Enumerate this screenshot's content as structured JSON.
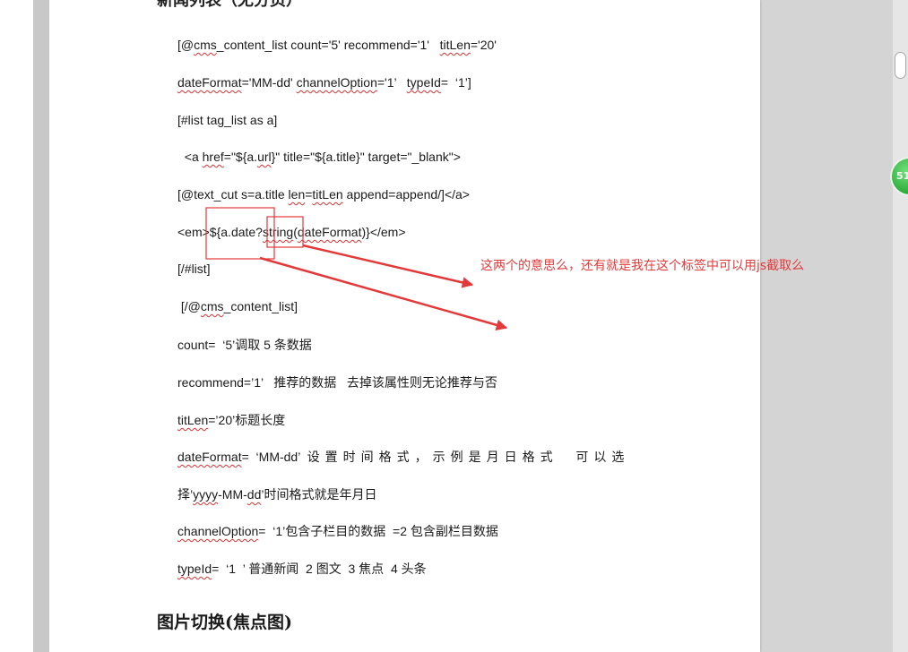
{
  "document": {
    "top_heading": "新闻列表（无分页）",
    "lines": {
      "l1_a": "[@",
      "l1_cms": "cms",
      "l1_b": "_content_list count='5' recommend='1'   ",
      "l1_titLen": "titLen",
      "l1_c": "='20'",
      "l2_dateFormat": "dateFormat",
      "l2_a": "='MM-dd' ",
      "l2_channelOption": "channelOption",
      "l2_b": "='1’   ",
      "l2_typeId": "typeId",
      "l2_c": "=  ‘1’]",
      "l3": "[#list tag_list as a]",
      "l4_a": "  <a ",
      "l4_href": "href",
      "l4_b": "=\"${a.",
      "l4_url": "url",
      "l4_c": "}\" title=\"${a.title}\" target=\"_blank\">",
      "l5_a": "[@text_cut s=a.title ",
      "l5_len": "len",
      "l5_b": "=",
      "l5_titLen": "titLen",
      "l5_c": " append=append/]</a>",
      "l6_a": "<em>${a.date?",
      "l6_string": "string",
      "l6_b": "(",
      "l6_dateFormat": "dateFormat",
      "l6_c": ")}</em>",
      "l7": "[/#list]",
      "l8_a": " [/@",
      "l8_cms": "cms",
      "l8_b": "_content_list]",
      "l9": "count=  ‘5’调取 5 条数据",
      "l10": "recommend=’1’   推荐的数据   去掉该属性则无论推荐与否",
      "l11_titLen": "titLen",
      "l11_b": "=’20’标题长度",
      "l12_dateFormat": "dateFormat",
      "l12_b": "=  ‘MM-dd’  ",
      "l12_c": "设置时间格式，示例是月日格式  可以选",
      "l13_a": "择’",
      "l13_yyyy": "yyyy",
      "l13_b": "-MM-",
      "l13_dd": "dd",
      "l13_c": "’时间格式就是年月日",
      "l14_channelOption": "channelOption",
      "l14_b": "=  ‘1’包含子栏目的数据  =2 包含副栏目数据",
      "l15_typeId": "typeId",
      "l15_b": "=  ‘1  ’ 普通新闻  2 图文  3 焦点  4 头条"
    },
    "heading2": "图片切换(焦点图)"
  },
  "annotation": {
    "text": "这两个的意思么，还有就是我在这个标签中可以用js截取么",
    "color": "#e23a3a"
  },
  "badge": {
    "label": "51"
  },
  "colors": {
    "page": "#ffffff",
    "background": "#d6d6d6",
    "spellcheck": "#d83232"
  }
}
